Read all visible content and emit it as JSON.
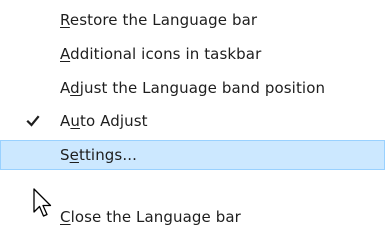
{
  "menu": {
    "items": [
      {
        "prefix": "",
        "accel": "R",
        "suffix": "estore the Language bar",
        "checked": false,
        "highlighted": false
      },
      {
        "prefix": "",
        "accel": "A",
        "suffix": "dditional icons in taskbar",
        "checked": false,
        "highlighted": false
      },
      {
        "prefix": "A",
        "accel": "d",
        "suffix": "just the Language band position",
        "checked": false,
        "highlighted": false
      },
      {
        "prefix": "A",
        "accel": "u",
        "suffix": "to Adjust",
        "checked": true,
        "highlighted": false
      },
      {
        "prefix": "S",
        "accel": "e",
        "suffix": "ttings...",
        "checked": false,
        "highlighted": true
      },
      {
        "prefix": "",
        "accel": "C",
        "suffix": "lose the Language bar",
        "checked": false,
        "highlighted": false
      }
    ]
  },
  "icons": {
    "check": "checkmark-icon",
    "cursor": "arrow-cursor-icon"
  },
  "colors": {
    "highlight_bg": "#cce8ff",
    "highlight_border": "#99d1ff",
    "text": "#1e1e1e"
  }
}
